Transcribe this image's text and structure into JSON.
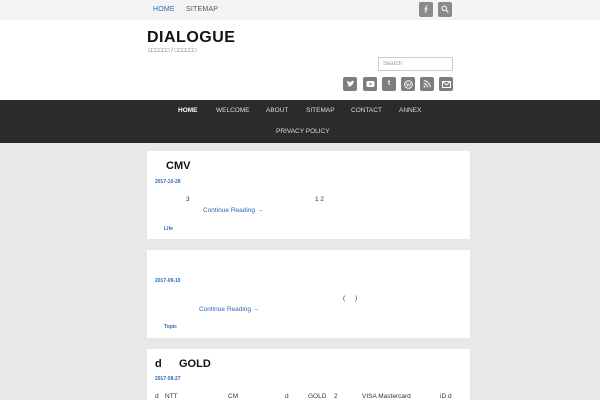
{
  "topbar": {
    "links": [
      "HOME",
      "SITEMAP"
    ],
    "icon_names": [
      "wordpress-icon",
      "search-icon"
    ]
  },
  "site": {
    "title": "DIALOGUE",
    "description": "□□□□□□ / □□□□□□"
  },
  "search": {
    "placeholder": "Search"
  },
  "social_icons": [
    "twitter-icon",
    "youtube-icon",
    "tumblr-icon",
    "wordpress-icon",
    "rss-icon",
    "email-icon"
  ],
  "main_nav": {
    "items": [
      "HOME",
      "WELCOME",
      "ABOUT",
      "SITEMAP",
      "CONTACT",
      "ANNEX",
      "PRIVACY POLICY"
    ]
  },
  "posts": [
    {
      "title": "CMV",
      "date": "2017-10-28",
      "text": [
        "3",
        "1 2"
      ],
      "more": "Continue Reading →",
      "tag": "Life"
    },
    {
      "title": "",
      "date": "2017-09-10",
      "text": [
        "(",
        ")"
      ],
      "more": "Continue Reading →",
      "tag": "Topic"
    },
    {
      "title_parts": [
        "d",
        "GOLD"
      ],
      "date": "2017-08-27",
      "text": [
        "d",
        "NTT",
        "CM",
        "d",
        "GOLD",
        "2",
        "VISA Mastercard",
        "iD d"
      ]
    }
  ],
  "colors": {
    "accent": "#2a6ab0",
    "nav_bg": "#2b2b2b",
    "page_bg": "#e8e8e8"
  }
}
